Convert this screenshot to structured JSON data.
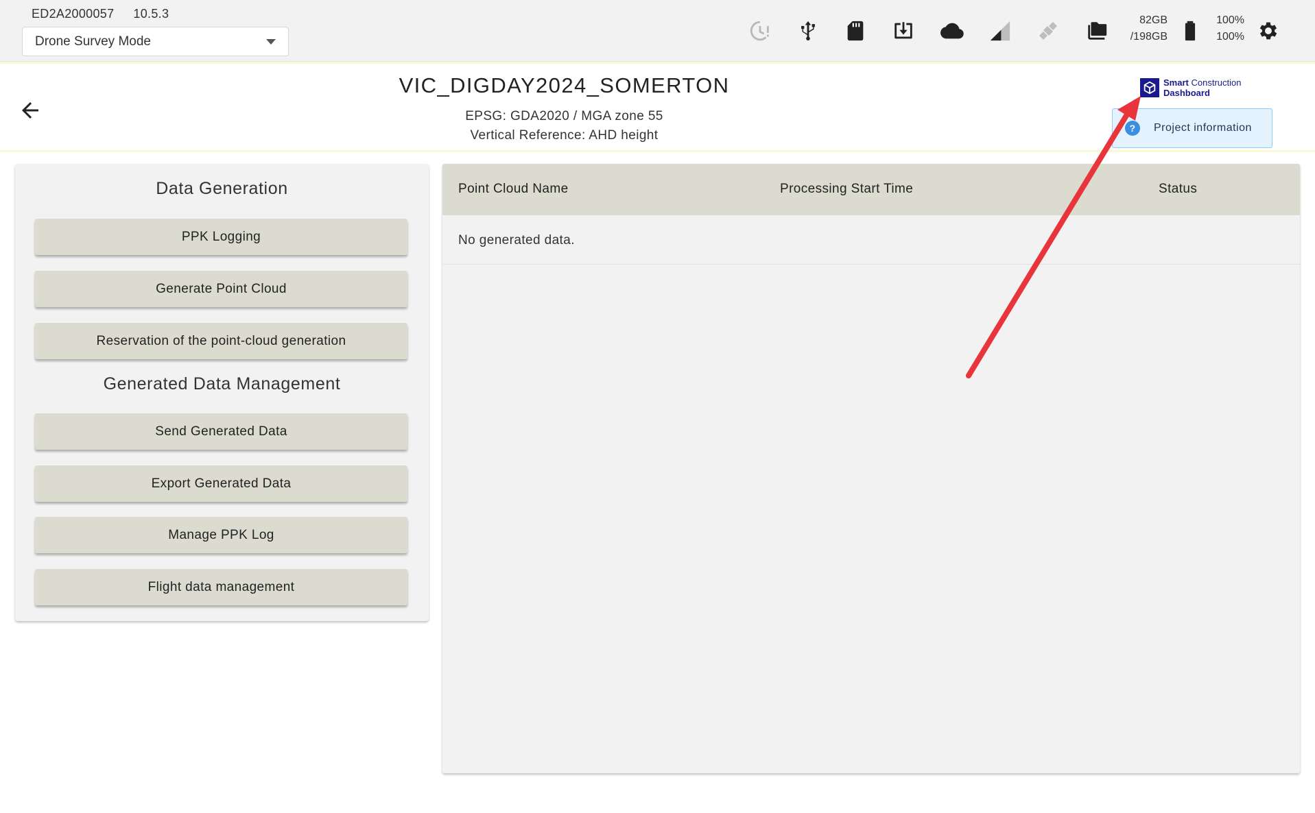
{
  "device": {
    "serial": "ED2A2000057",
    "version": "10.5.3"
  },
  "mode_select": {
    "value": "Drone Survey Mode"
  },
  "status_bar": {
    "icons": [
      "timer-alert-icon",
      "usb-icon",
      "sd-card-icon",
      "download-icon",
      "cloud-icon",
      "signal-icon",
      "satellite-icon",
      "folder-icon",
      "battery-icon",
      "gear-icon"
    ],
    "storage_free": "82GB",
    "storage_total": "/198GB",
    "battery_1": "100%",
    "battery_2": "100%"
  },
  "project": {
    "title": "VIC_DIGDAY2024_SOMERTON",
    "epsg": "EPSG: GDA2020 / MGA zone 55",
    "vertical_reference": "Vertical Reference: AHD height",
    "logo_line1_bold": "Smart",
    "logo_line1_light": "Construction",
    "logo_line2": "Dashboard",
    "info_button": "Project information"
  },
  "left_panel": {
    "data_generation_title": "Data Generation",
    "data_generation_buttons": [
      "PPK Logging",
      "Generate Point Cloud",
      "Reservation of the point-cloud generation"
    ],
    "management_title": "Generated Data Management",
    "management_buttons": [
      "Send Generated Data",
      "Export Generated Data",
      "Manage PPK Log",
      "Flight data management"
    ]
  },
  "table": {
    "columns": [
      "Point Cloud Name",
      "Processing Start Time",
      "Status"
    ],
    "empty_message": "No generated data."
  },
  "colors": {
    "topbar_bg": "#f2f2f2",
    "panel_bg": "#f2f2f2",
    "button_bg": "#dcdbd0",
    "info_button_bg": "#e3f2fd",
    "logo_blue": "#1a1a8c",
    "annotation_arrow": "#e8353b"
  }
}
